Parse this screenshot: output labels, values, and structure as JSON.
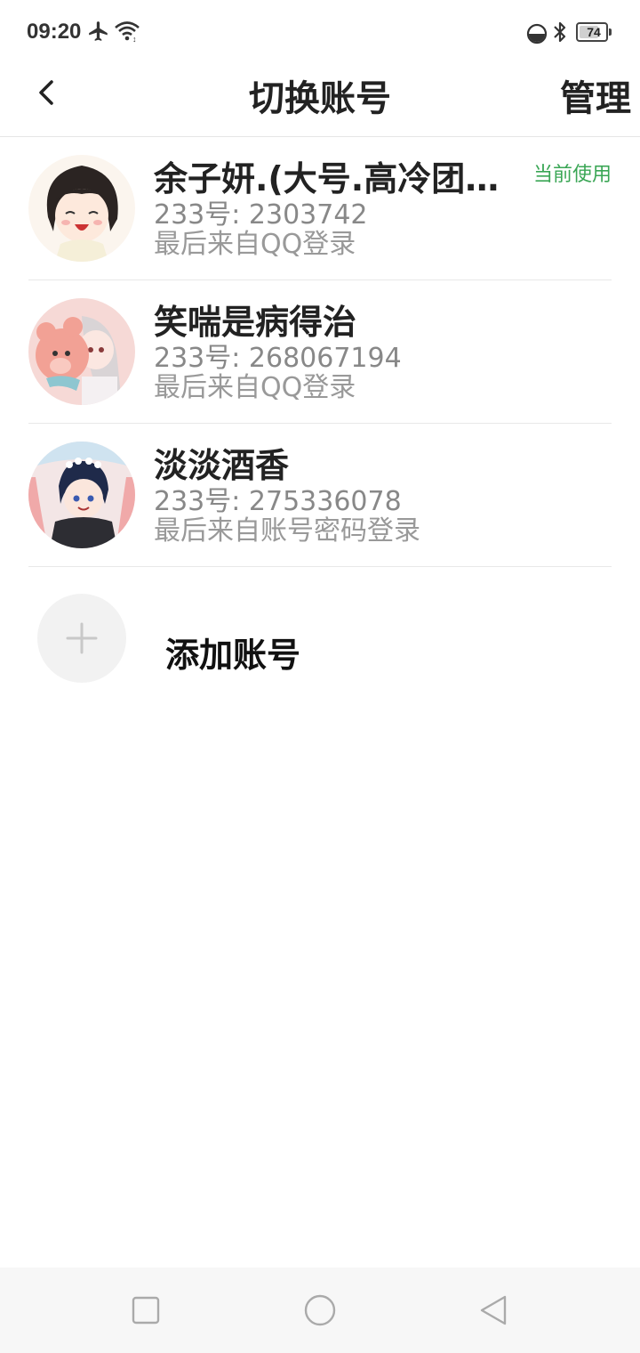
{
  "status_bar": {
    "time": "09:20",
    "battery": "74",
    "battery_level": 0.74,
    "icons": [
      "airplane-mode-icon",
      "wifi-icon",
      "dnd-icon",
      "bluetooth-icon",
      "battery-icon"
    ]
  },
  "header": {
    "title": "切换账号",
    "manage_label": "管理",
    "back_icon": "chevron-left-icon"
  },
  "accounts": [
    {
      "name": "余子妍.(大号.高冷团…",
      "id_text": "233号: 2303742",
      "login_text": "最后来自QQ登录",
      "badge": "当前使用"
    },
    {
      "name": "笑喘是病得治",
      "id_text": "233号: 268067194",
      "login_text": "最后来自QQ登录"
    },
    {
      "name": "淡淡酒香",
      "id_text": "233号: 275336078",
      "login_text": "最后来自账号密码登录"
    }
  ],
  "add_account": {
    "label": "添加账号",
    "icon": "plus-icon"
  },
  "nav_bar": {
    "icons": [
      "recents-square-icon",
      "home-circle-icon",
      "back-triangle-icon"
    ]
  },
  "colors": {
    "accent_green": "#3aa655",
    "text_primary": "#222222",
    "text_secondary": "#888888",
    "divider": "#e8e8e8",
    "nav_bg": "#f7f7f7"
  }
}
